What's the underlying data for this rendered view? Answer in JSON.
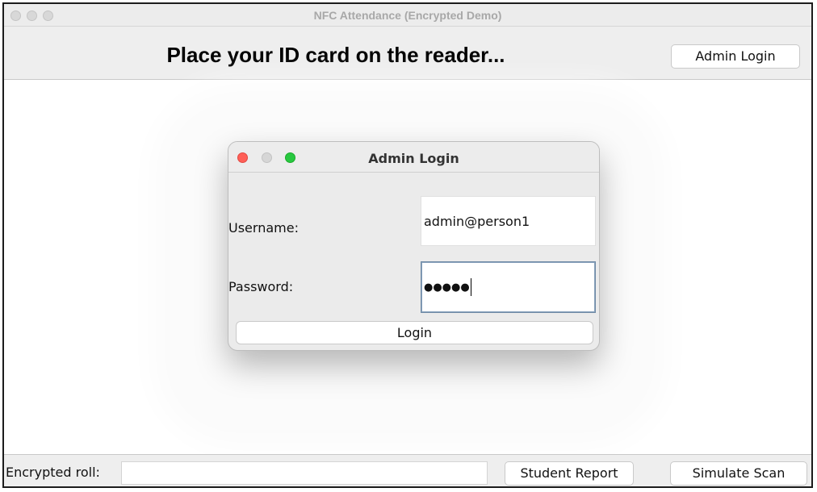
{
  "window": {
    "title": "NFC Attendance (Encrypted Demo)"
  },
  "header": {
    "title": "Place your ID card on the reader...",
    "admin_login_label": "Admin Login"
  },
  "dialog": {
    "title": "Admin Login",
    "username_label": "Username:",
    "username_value": "admin@person1",
    "password_label": "Password:",
    "password_masked": "●●●●●",
    "login_label": "Login"
  },
  "footer": {
    "roll_label": "Encrypted roll:",
    "roll_value": "",
    "student_report_label": "Student Report",
    "simulate_scan_label": "Simulate Scan"
  },
  "colors": {
    "close": "#ff5f57",
    "minimize_inactive": "#d6d6d6",
    "zoom": "#28c840",
    "focus_ring": "#6f8aa5"
  }
}
